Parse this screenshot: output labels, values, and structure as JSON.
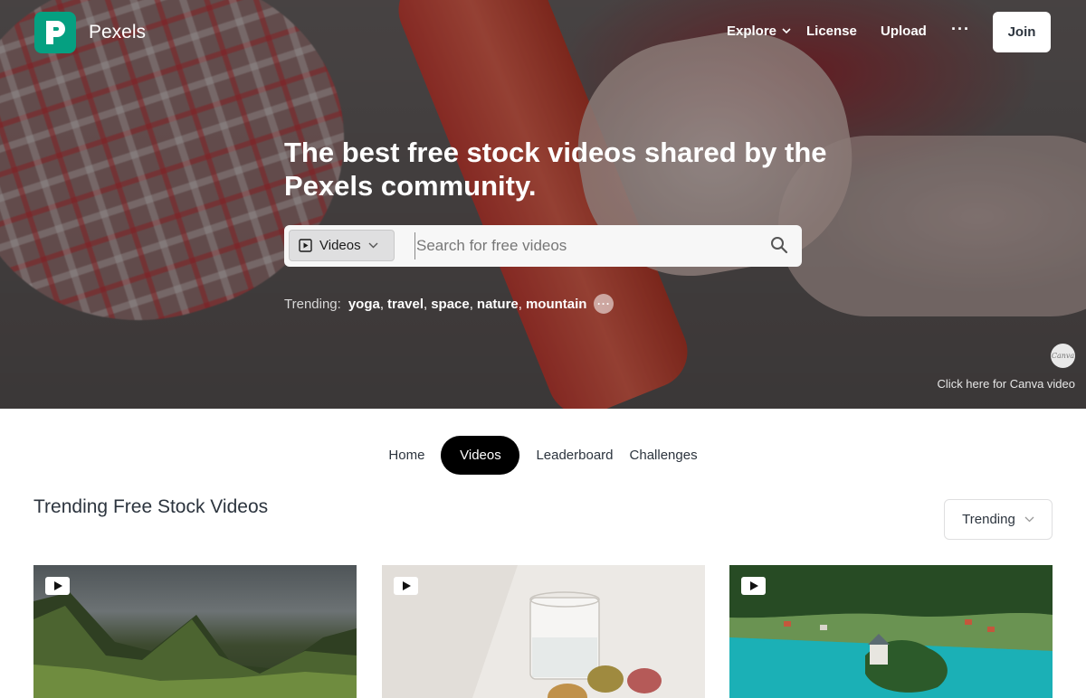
{
  "brand": {
    "name": "Pexels",
    "logo_letter": "P",
    "color": "#05a081"
  },
  "nav": {
    "explore": "Explore",
    "license": "License",
    "upload": "Upload",
    "more": "···",
    "join": "Join"
  },
  "hero": {
    "headline": "The best free stock videos shared by the Pexels community.",
    "search": {
      "type_label": "Videos",
      "placeholder": "Search for free videos"
    },
    "trending": {
      "label": "Trending:",
      "terms": [
        "yoga",
        "travel",
        "space",
        "nature",
        "mountain"
      ],
      "more": "···"
    },
    "canva": {
      "logo": "Canva",
      "link": "Click here for Canva video"
    }
  },
  "tabs": [
    {
      "label": "Home",
      "active": false
    },
    {
      "label": "Videos",
      "active": true
    },
    {
      "label": "Leaderboard",
      "active": false
    },
    {
      "label": "Challenges",
      "active": false
    }
  ],
  "section": {
    "title": "Trending Free Stock Videos",
    "sort": "Trending"
  },
  "videos": [
    {
      "subject": "mountains",
      "icon": "play-icon"
    },
    {
      "subject": "macarons-and-glass",
      "icon": "play-icon"
    },
    {
      "subject": "lake-village",
      "icon": "play-icon"
    }
  ]
}
